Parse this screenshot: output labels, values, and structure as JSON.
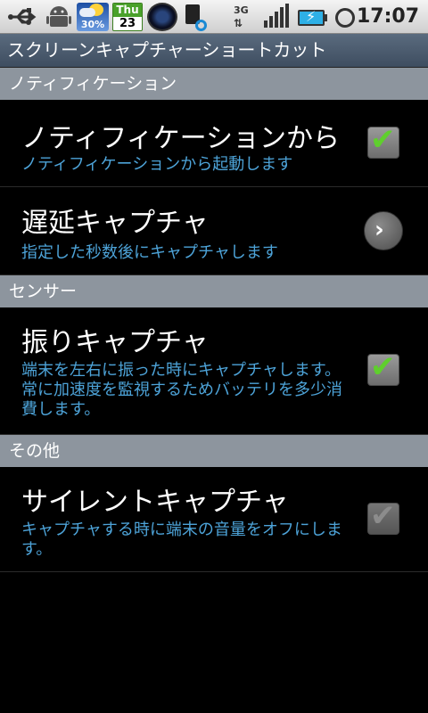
{
  "status_bar": {
    "icons": [
      "usb-icon",
      "android-icon",
      "weather-icon",
      "calendar-icon",
      "camera-app-icon",
      "sd-card-icon",
      "3g-icon",
      "signal-icon",
      "battery-charging-icon",
      "alarm-icon"
    ],
    "weather_percent": "30%",
    "calendar_day": "Thu",
    "calendar_date": "23",
    "network_label": "3G",
    "time": "17:07"
  },
  "app": {
    "title": "スクリーンキャプチャーショートカット"
  },
  "sections": {
    "notification": {
      "header": "ノティフィケーション",
      "item": {
        "title": "ノティフィケーションから",
        "summary": "ノティフィケーションから起動します",
        "checked": true
      }
    },
    "delay": {
      "item": {
        "title": "遅延キャプチャ",
        "summary": "指定した秒数後にキャプチャします",
        "action_icon": "chevron-right-icon"
      }
    },
    "sensor": {
      "header": "センサー",
      "item": {
        "title": "振りキャプチャ",
        "summary": "端末を左右に振った時にキャプチャします。常に加速度を監視するためバッテリを多少消費します。",
        "checked": true
      }
    },
    "other": {
      "header": "その他",
      "item": {
        "title": "サイレントキャプチャ",
        "summary": "キャプチャする時に端末の音量をオフにします。",
        "checked": true,
        "enabled": false
      }
    }
  },
  "colors": {
    "summary_text": "#4da3d8",
    "check_green": "#5fcf2d",
    "category_bg": "#8d959e"
  }
}
